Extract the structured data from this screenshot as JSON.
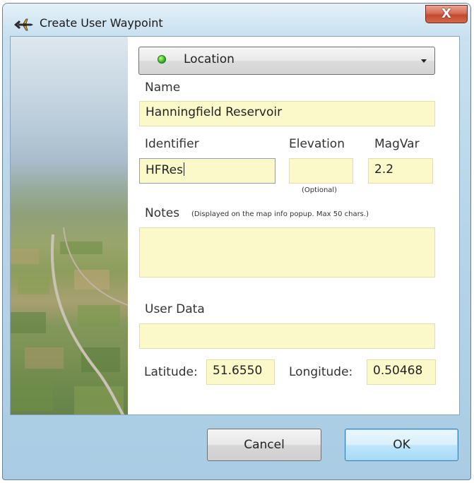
{
  "window": {
    "title": "Create User Waypoint",
    "close_label": "X"
  },
  "form": {
    "type_dropdown": {
      "selected": "Location",
      "status_color": "#27a520"
    },
    "name": {
      "label": "Name",
      "value": "Hanningfield Reservoir"
    },
    "identifier": {
      "label": "Identifier",
      "value": "HFRes"
    },
    "elevation": {
      "label": "Elevation",
      "value": "",
      "hint": "(Optional)"
    },
    "magvar": {
      "label": "MagVar",
      "value": "2.2"
    },
    "notes": {
      "label": "Notes",
      "hint": "(Displayed on the map info popup. Max 50 chars.)",
      "value": ""
    },
    "user_data": {
      "label": "User Data",
      "value": ""
    },
    "latitude": {
      "label": "Latitude:",
      "value": "51.6550"
    },
    "longitude": {
      "label": "Longitude:",
      "value": "0.50468"
    }
  },
  "buttons": {
    "cancel": "Cancel",
    "ok": "OK"
  },
  "colors": {
    "field_background": "#fbf8c9",
    "frame_blue": "#b9d6ea"
  }
}
